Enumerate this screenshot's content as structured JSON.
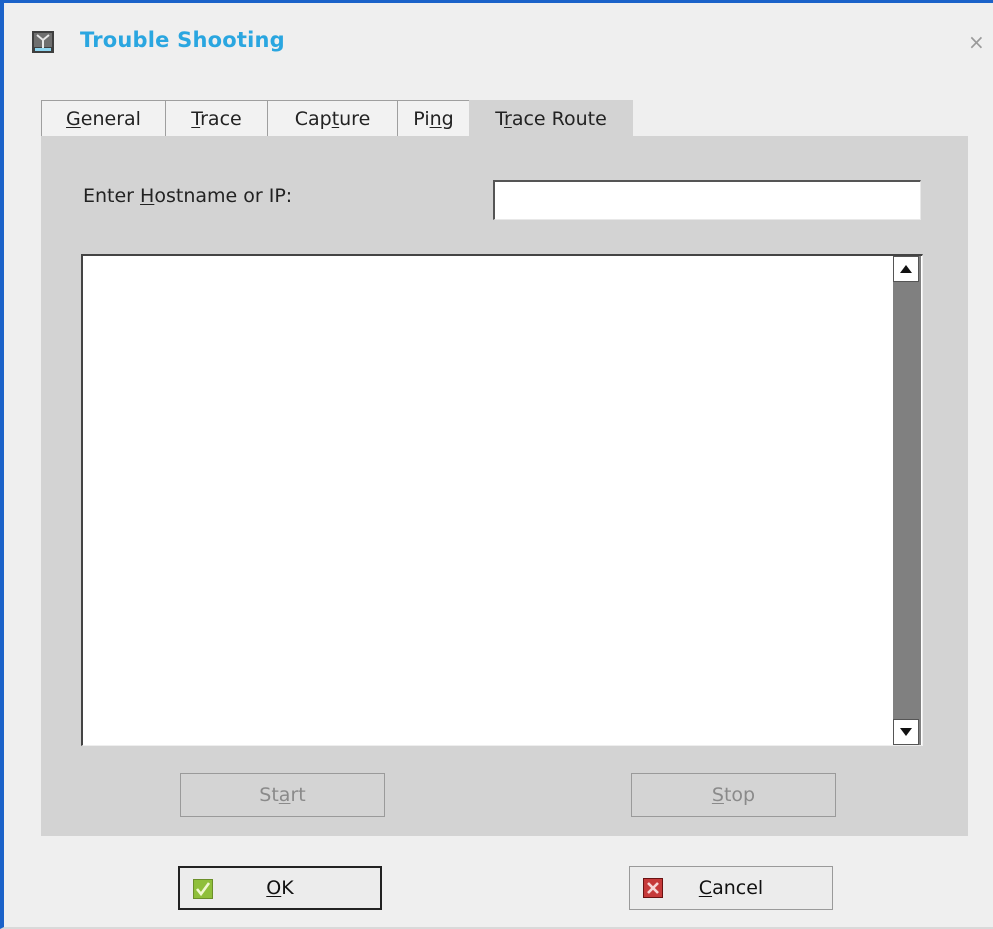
{
  "window": {
    "title": "Trouble Shooting",
    "close_glyph": "×",
    "accent_color": "#2aa6e0",
    "frame_color": "#1b62c9"
  },
  "tabs": [
    {
      "label": "General",
      "active": false
    },
    {
      "label": "Trace",
      "active": false
    },
    {
      "label": "Capture",
      "active": false
    },
    {
      "label": "Ping",
      "active": false
    },
    {
      "label": "Trace Route",
      "active": true
    }
  ],
  "trace_route": {
    "host_label": "Enter Hostname or IP:",
    "host_value": "",
    "output_text": "",
    "start_label": "Start",
    "stop_label": "Stop"
  },
  "dialog_buttons": {
    "ok_label": "OK",
    "cancel_label": "Cancel",
    "ok_icon": "check-icon",
    "cancel_icon": "x-icon"
  }
}
